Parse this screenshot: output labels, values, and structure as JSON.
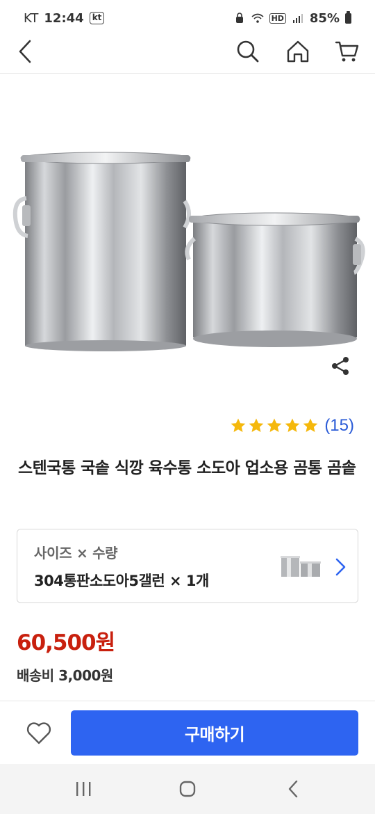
{
  "status_bar": {
    "carrier": "KT",
    "time": "12:44",
    "carrier_badge": "kt",
    "network_badge": "HD",
    "battery": "85%"
  },
  "header": {
    "back_icon": "chevron-left-icon",
    "search_icon": "search-icon",
    "home_icon": "home-icon",
    "cart_icon": "cart-icon"
  },
  "product": {
    "image_desc": "stainless-steel-stockpots",
    "rating_stars": 5,
    "review_count": "(15)",
    "title": "스텐국통 국솥 식깡 육수통 소도아 업소용 곰통 곰솥",
    "option": {
      "label": "사이즈 × 수량",
      "value": "304통판소도아5갤런 × 1개"
    },
    "price": "60,500원",
    "shipping": "배송비 3,000원"
  },
  "actions": {
    "wish_icon": "heart-icon",
    "buy_label": "구매하기"
  },
  "colors": {
    "accent": "#2e64f1",
    "price": "#c8200e",
    "star": "#f5b80c",
    "review_count": "#2a5bd7"
  },
  "system_nav": {
    "recents_icon": "recents-icon",
    "home_icon": "circle-home-icon",
    "back_icon": "back-chevron-icon"
  }
}
